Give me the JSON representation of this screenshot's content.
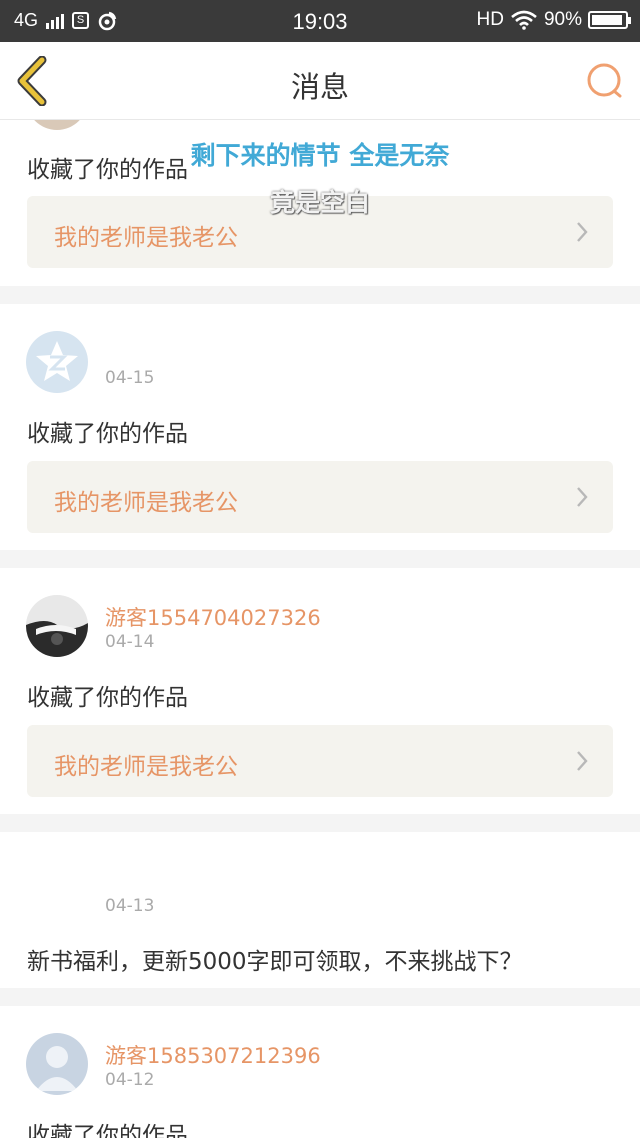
{
  "status_bar": {
    "network": "4G",
    "icon1": "s-app-icon",
    "icon2": "weibo-icon",
    "time": "19:03",
    "hd": "HD",
    "battery": "90%",
    "battery_level": 0.9
  },
  "header": {
    "title": "消息",
    "back_icon": "chevron-left-icon",
    "search_icon": "search-icon"
  },
  "overlay": {
    "line1": "剩下来的情节 全是无奈",
    "line2": "竟是空白"
  },
  "messages": [
    {
      "message": "收藏了你的作品",
      "work_title": "我的老师是我老公"
    },
    {
      "date": "04-15",
      "message": "收藏了你的作品",
      "work_title": "我的老师是我老公"
    },
    {
      "username": "游客1554704027326",
      "date": "04-14",
      "message": "收藏了你的作品",
      "work_title": "我的老师是我老公"
    },
    {
      "date": "04-13",
      "message": "新书福利，更新5000字即可领取，不来挑战下？"
    },
    {
      "username": "游客1585307212396",
      "date": "04-12",
      "message": "收藏了你的作品"
    }
  ],
  "colors": {
    "accent": "#e69566",
    "header_icon": "#e8c23a",
    "lyric_blue": "#41a9d6"
  }
}
